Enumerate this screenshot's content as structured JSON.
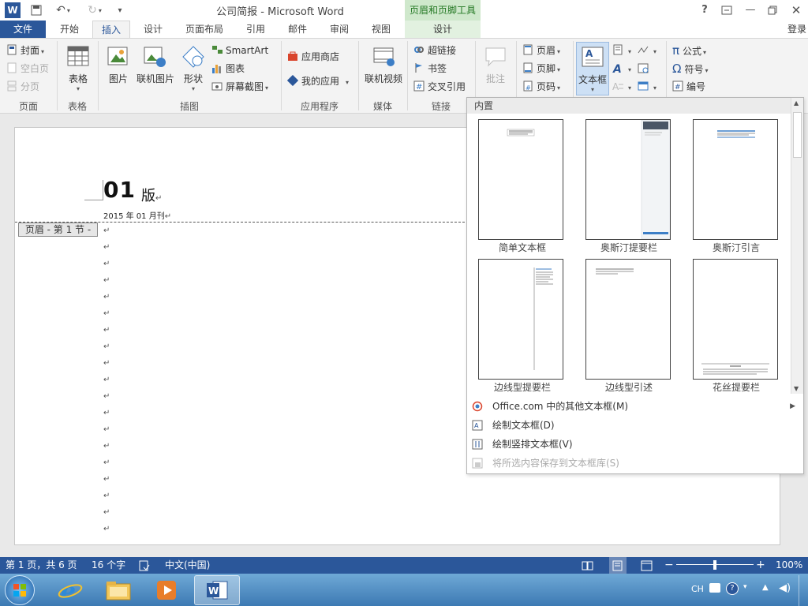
{
  "window": {
    "title": "公司简报 - Microsoft Word",
    "context_title": "页眉和页脚工具",
    "help": "?",
    "login": "登录"
  },
  "tabs": [
    "文件",
    "开始",
    "插入",
    "设计",
    "页面布局",
    "引用",
    "邮件",
    "审阅",
    "视图",
    "设计"
  ],
  "ribbon": {
    "pages": {
      "items": [
        "封面",
        "空白页",
        "分页"
      ],
      "label": "页面"
    },
    "table": {
      "button": "表格",
      "label": "表格"
    },
    "illustrations": {
      "picture": "图片",
      "online_picture": "联机图片",
      "shapes": "形状",
      "smartart": "SmartArt",
      "chart": "图表",
      "screenshot": "屏幕截图",
      "label": "插图"
    },
    "apps": {
      "store": "应用商店",
      "my_apps": "我的应用",
      "label": "应用程序"
    },
    "media": {
      "online_video": "联机视频",
      "label": "媒体"
    },
    "links": {
      "hyperlink": "超链接",
      "bookmark": "书签",
      "cross_ref": "交叉引用",
      "label": "链接"
    },
    "comments": {
      "comment": "批注"
    },
    "header_footer": {
      "header": "页眉",
      "footer": "页脚",
      "page_number": "页码"
    },
    "text": {
      "textbox": "文本框"
    },
    "symbols": {
      "equation": "公式",
      "symbol": "符号",
      "number": "编号"
    }
  },
  "document": {
    "heading": "01",
    "heading_suffix": "版",
    "date_line": "2015 年 01 月刊",
    "paragraph_mark": "↵",
    "header_tag": "页眉 - 第 1 节 -"
  },
  "gallery": {
    "section": "内置",
    "items": [
      "简单文本框",
      "奥斯汀提要栏",
      "奥斯汀引言",
      "边线型提要栏",
      "边线型引述",
      "花丝提要栏"
    ],
    "menu": [
      {
        "label": "Office.com 中的其他文本框(M)",
        "enabled": true
      },
      {
        "label": "绘制文本框(D)",
        "enabled": true
      },
      {
        "label": "绘制竖排文本框(V)",
        "enabled": true
      },
      {
        "label": "将所选内容保存到文本框库(S)",
        "enabled": false
      }
    ]
  },
  "status": {
    "page": "第 1 页，共 6 页",
    "words": "16 个字",
    "language": "中文(中国)",
    "zoom": "100%",
    "zoom_value": 100
  },
  "taskbar": {
    "ime": "CH"
  },
  "colors": {
    "word_blue": "#2b579a",
    "context_green": "#227722",
    "context_bg": "#e2f1e0"
  }
}
